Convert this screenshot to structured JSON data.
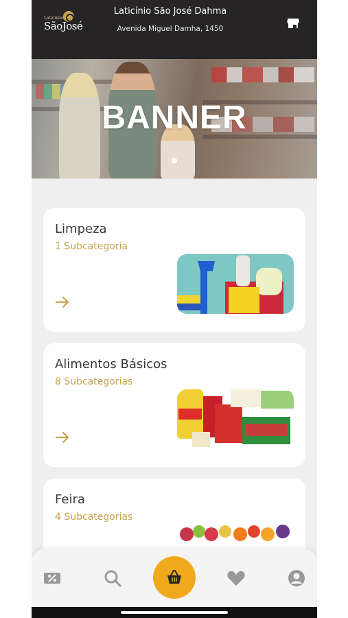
{
  "header": {
    "logo_small": "Laticínios",
    "logo_big": "SãoJosé",
    "store_name": "Laticínio São José Dahma",
    "store_address": "Avenida Miguel Damha, 1450",
    "store_icon": "store-icon"
  },
  "banner": {
    "title": "BANNER"
  },
  "categories": [
    {
      "title": "Limpeza",
      "subtitle": "1 Subcategoria",
      "image": "cleaning-products"
    },
    {
      "title": "Alimentos Básicos",
      "subtitle": "8 Subcategorias",
      "image": "grocery-products"
    },
    {
      "title": "Feira",
      "subtitle": "4 Subcategorias",
      "image": "fruits-vegetables"
    }
  ],
  "nav": {
    "items": [
      "discount-icon",
      "search-icon",
      "basket-icon",
      "heart-icon",
      "user-icon"
    ]
  },
  "colors": {
    "header_bg": "#262424",
    "accent": "#c9a24e",
    "cart_button": "#f0a81c",
    "background": "#efefef"
  }
}
